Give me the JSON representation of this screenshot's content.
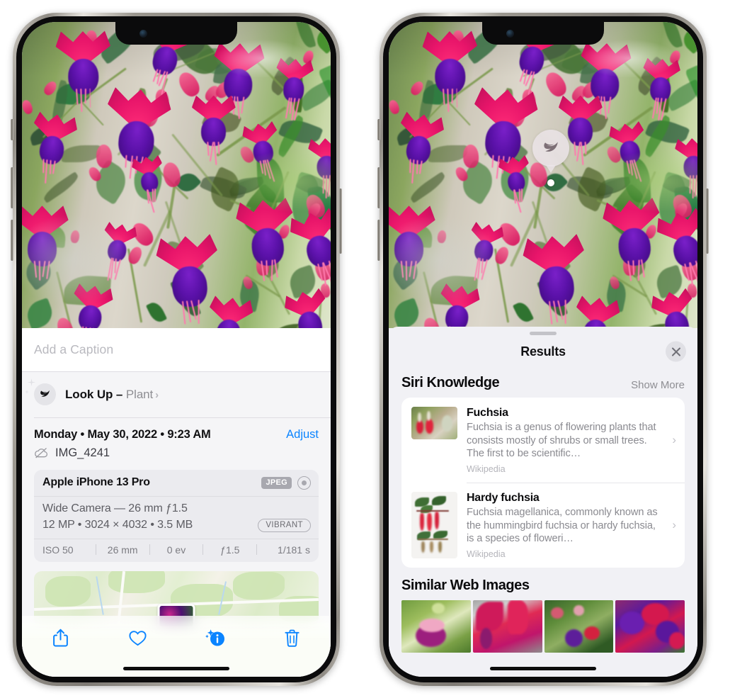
{
  "left_phone": {
    "caption_field": {
      "placeholder": "Add a Caption",
      "value": ""
    },
    "lookup_row": {
      "icon": "leaf-icon",
      "label": "Look Up – ",
      "subject": "Plant",
      "chevron": "›"
    },
    "metadata": {
      "date_line": "Monday • May 30, 2022 • 9:23 AM",
      "adjust_label": "Adjust",
      "cloud_icon": "icloud-slash-icon",
      "filename": "IMG_4241"
    },
    "camera_card": {
      "model": "Apple iPhone 13 Pro",
      "format_badge": "JPEG",
      "aperture_icon": "aperture-icon",
      "lens_line": "Wide Camera — 26 mm ƒ1.5",
      "specs_line": "12 MP • 3024 × 4032 • 3.5 MB",
      "style_badge": "VIBRANT",
      "exif": [
        "ISO 50",
        "26 mm",
        "0 ev",
        "ƒ1.5",
        "1/181 s"
      ]
    },
    "toolbar": [
      {
        "name": "share-button",
        "icon": "share-icon"
      },
      {
        "name": "favorite-button",
        "icon": "heart-icon"
      },
      {
        "name": "info-button",
        "icon": "info-sparkle-icon"
      },
      {
        "name": "delete-button",
        "icon": "trash-icon"
      }
    ]
  },
  "right_phone": {
    "lookup_badge": {
      "icon": "leaf-icon"
    },
    "sheet": {
      "title": "Results",
      "close_icon": "close-icon"
    },
    "siri_knowledge": {
      "title": "Siri Knowledge",
      "action": "Show More",
      "items": [
        {
          "title": "Fuchsia",
          "description": "Fuchsia is a genus of flowering plants that consists mostly of shrubs or small trees. The first to be scientific…",
          "source": "Wikipedia",
          "chevron": "›"
        },
        {
          "title": "Hardy fuchsia",
          "description": "Fuchsia magellanica, commonly known as the hummingbird fuchsia or hardy fuchsia, is a species of floweri…",
          "source": "Wikipedia",
          "chevron": "›"
        }
      ]
    },
    "similar_web_images": {
      "title": "Similar Web Images",
      "thumbnail_count": 4
    }
  },
  "colors": {
    "accent_blue": "#0a84ff",
    "sheet_bg": "#f1f1f5",
    "card_bg": "#ffffff",
    "secondary_text": "#8e8e93"
  }
}
